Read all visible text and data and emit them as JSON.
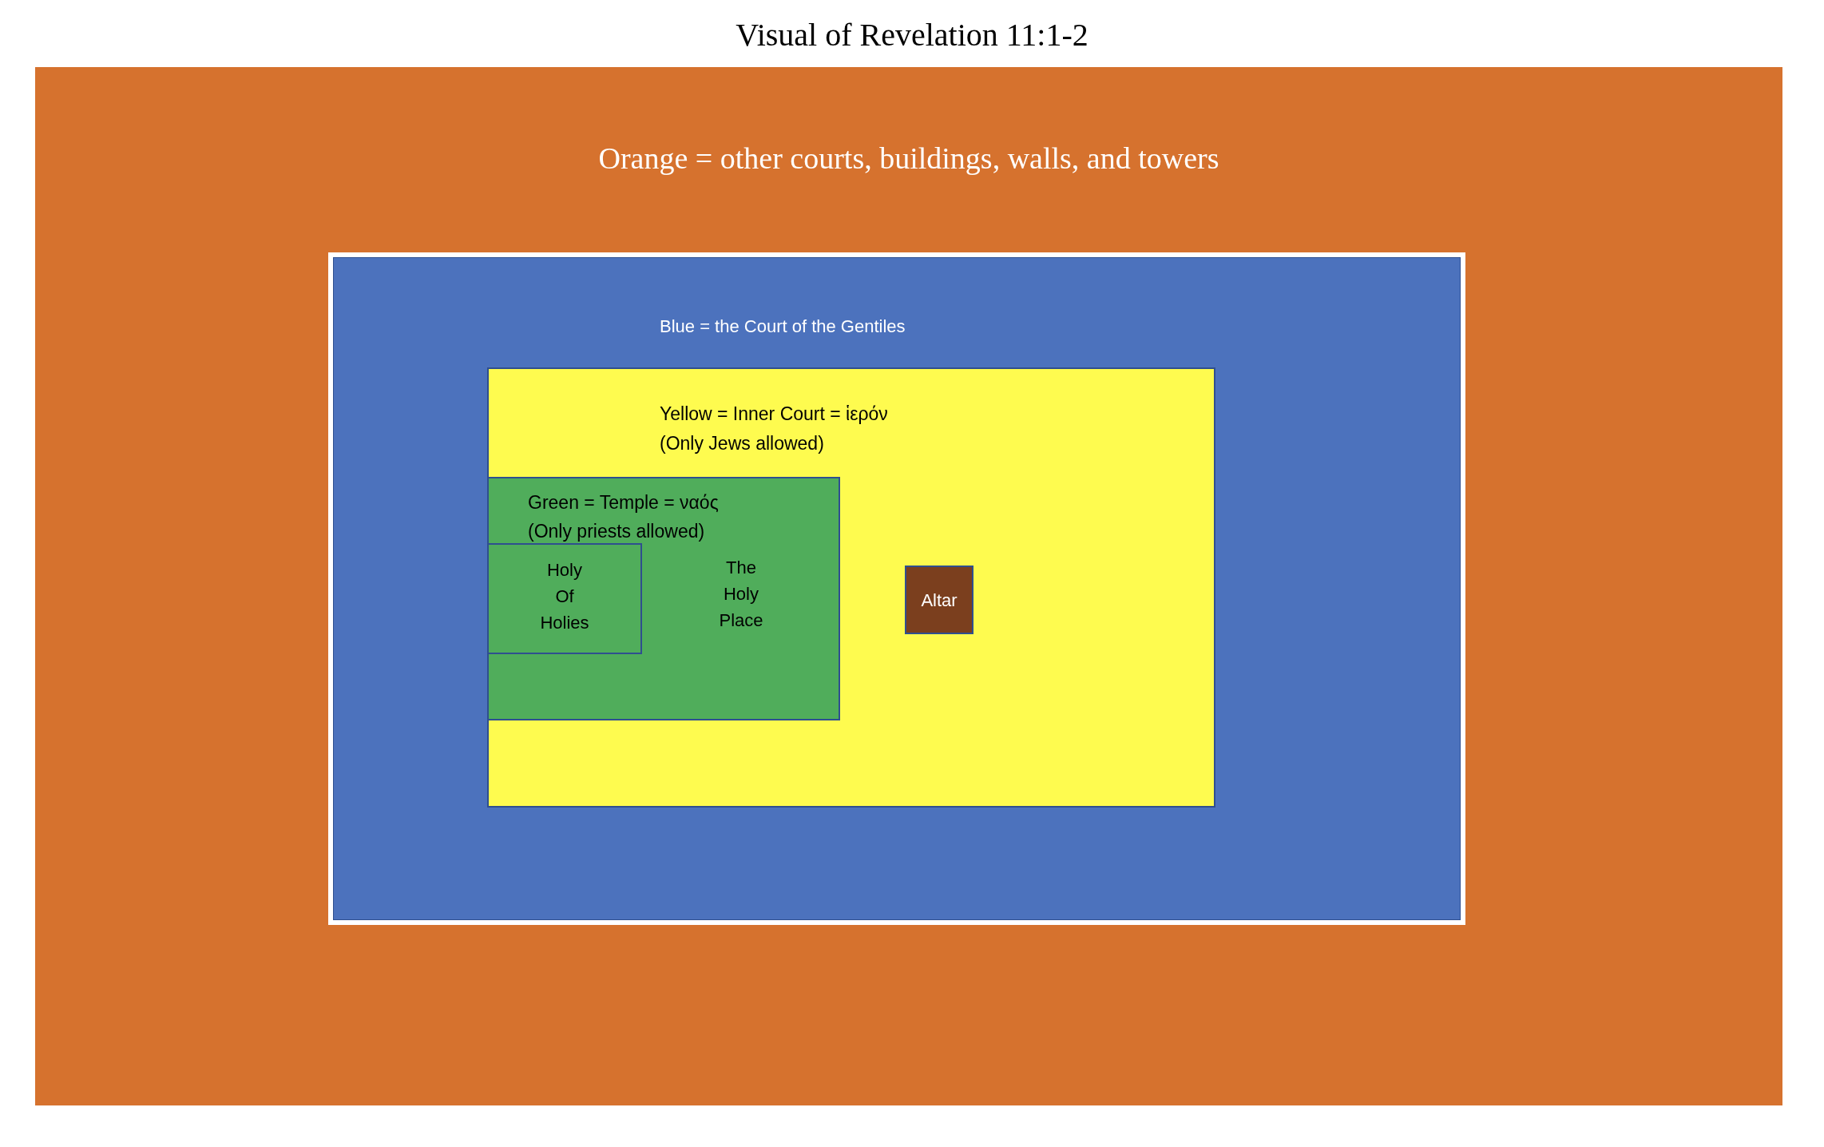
{
  "title": "Visual of Revelation 11:1-2",
  "outer_area": {
    "label": "Orange = other courts, buildings, walls, and towers"
  },
  "court_of_gentiles": {
    "label": "Blue = the Court of the Gentiles"
  },
  "inner_court": {
    "label_lines": [
      "Yellow = Inner Court = ἱερόν",
      "(Only Jews allowed)"
    ]
  },
  "temple": {
    "label_lines": [
      "Green = Temple = ναός",
      "(Only priests allowed)"
    ]
  },
  "holy_of_holies": {
    "label_lines": [
      "Holy",
      "Of",
      "Holies"
    ]
  },
  "holy_place": {
    "label_lines": [
      "The",
      "Holy",
      "Place"
    ]
  },
  "altar": {
    "label": "Altar"
  }
}
